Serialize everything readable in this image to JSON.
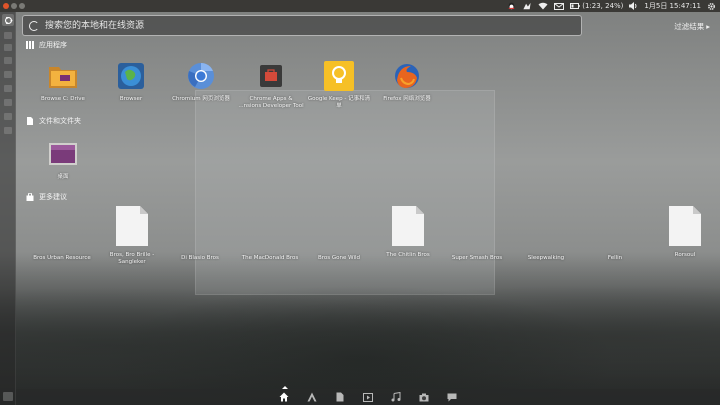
{
  "search": {
    "placeholder": "搜索您的本地和在线资源"
  },
  "filter": {
    "label": "过滤结果",
    "arrow": "▸"
  },
  "panel": {
    "battery": "(1:23, 24%)",
    "date_time": "1月5日 15:47:11"
  },
  "sections": {
    "apps": {
      "title": "应用程序",
      "items": [
        {
          "label": "Browse C: Drive",
          "icon": "folder-icon"
        },
        {
          "label": "Browser",
          "icon": "globe-icon"
        },
        {
          "label": "Chromium 网页浏览器",
          "icon": "chromium-icon"
        },
        {
          "label": "Chrome Apps &\n...nsions Developer Tool",
          "icon": "toolbox-icon"
        },
        {
          "label": "Google Keep - 记事和清\n单",
          "icon": "bulb-icon"
        },
        {
          "label": "Firefox 网络浏览器",
          "icon": "firefox-icon"
        }
      ]
    },
    "files": {
      "title": "文件和文件夹",
      "items": [
        {
          "label": "桌面",
          "icon": "desktop-folder-icon"
        }
      ]
    },
    "suggestions": {
      "title": "更多建议",
      "items": [
        {
          "label": "Bros Urban Resource",
          "has_icon": false
        },
        {
          "label": "Bros, Bro Brille -\nSangleker",
          "has_icon": true
        },
        {
          "label": "Di Blasio Bros",
          "has_icon": false
        },
        {
          "label": "The MacDonald Bros",
          "has_icon": false
        },
        {
          "label": "Bros Gone Wild",
          "has_icon": false
        },
        {
          "label": "The Chitlin Bros",
          "has_icon": true
        },
        {
          "label": "Super Smash Bros",
          "has_icon": false
        },
        {
          "label": "Sleepwalking",
          "has_icon": false
        },
        {
          "label": "Fellin",
          "has_icon": false
        },
        {
          "label": "Rorsoul",
          "has_icon": true
        }
      ]
    }
  },
  "lenses": [
    "home-lens-icon",
    "applications-lens-icon",
    "files-lens-icon",
    "video-lens-icon",
    "music-lens-icon",
    "photos-lens-icon",
    "social-lens-icon"
  ],
  "colors": {
    "accent": "#dd4814",
    "panel": "#3a3936",
    "keep_yellow": "#f6c026"
  }
}
